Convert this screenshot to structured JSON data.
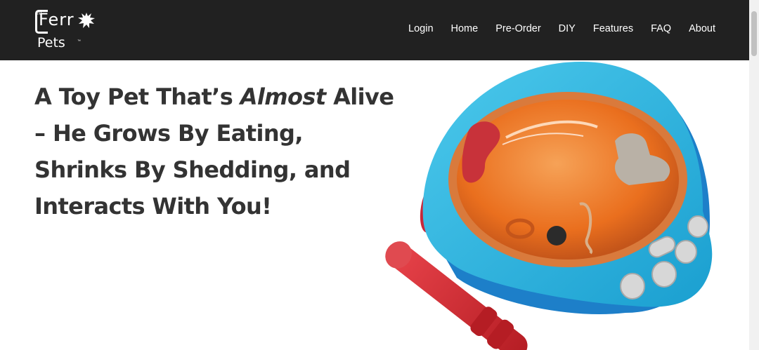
{
  "brand": {
    "name_line1": "Ferr",
    "name_line2": "Pets",
    "tm_small": "TM",
    "tm": "™"
  },
  "nav": {
    "items": [
      {
        "label": "Login"
      },
      {
        "label": "Home"
      },
      {
        "label": "Pre-Order"
      },
      {
        "label": "DIY"
      },
      {
        "label": "Features"
      },
      {
        "label": "FAQ"
      },
      {
        "label": "About"
      }
    ]
  },
  "hero": {
    "headline_part1": "A Toy Pet That’s ",
    "headline_emphasis": "Almost",
    "headline_part2": " Alive – He Grows By Eating, Shrinks By Shedding, and Interacts With You!",
    "image_alt": "Ferro Pets toy with orange dome, blue base and red magnetic wand"
  },
  "colors": {
    "header_bg": "#212121",
    "headline": "#333333",
    "toy_base": "#2ab3dd",
    "toy_dome": "#f07a2a",
    "wand": "#d0282e"
  }
}
